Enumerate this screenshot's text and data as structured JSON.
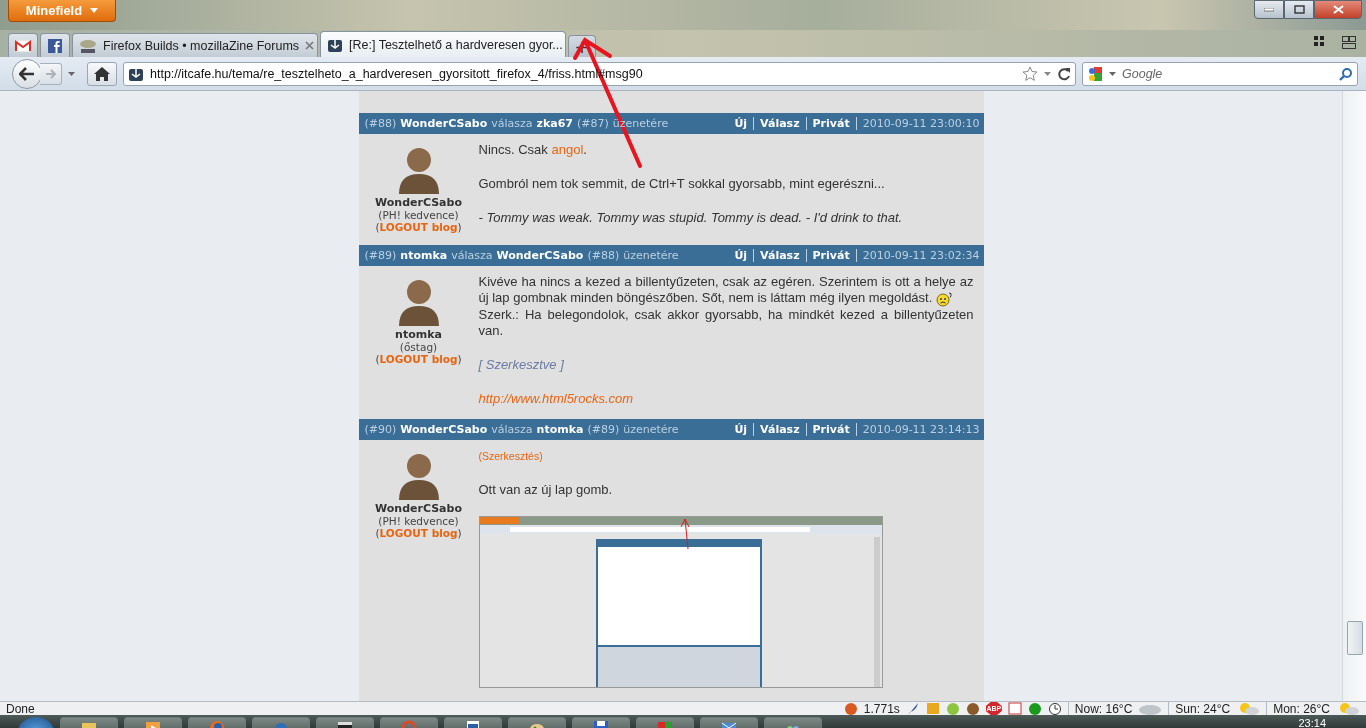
{
  "window": {
    "app_button": "Minefield"
  },
  "tabs": [
    {
      "kind": "pinned",
      "selected": false
    },
    {
      "kind": "pinned",
      "selected": false
    },
    {
      "kind": "normal",
      "label": "Firefox Builds • mozillaZine Forums",
      "selected": false
    },
    {
      "kind": "normal",
      "label": "[Re:] Tesztelhető a hardveresen gyor...",
      "selected": true
    }
  ],
  "new_tab": "+",
  "nav": {
    "url": "http://itcafe.hu/tema/re_tesztelheto_a_hardveresen_gyorsitott_firefox_4/friss.html#msg90",
    "search_placeholder": "Google"
  },
  "posts": [
    {
      "number": "(#88)",
      "author": "WonderCSabo",
      "verb": "válasza",
      "reply_to": "zka67",
      "reply_number": "(#87)",
      "suffix": "üzenetére",
      "actions": [
        "Új",
        "Válasz",
        "Privát"
      ],
      "date": "2010-09-11 23:00:10",
      "user": {
        "name": "WonderCSabo",
        "rank": "(PH! kedvence)",
        "blog_before": "(",
        "blog": "LOGOUT blog",
        "blog_after": ")"
      },
      "body": [
        {
          "kind": "para",
          "parts": [
            {
              "kind": "text",
              "text": "Nincs. Csak "
            },
            {
              "kind": "link",
              "text": "angol"
            },
            {
              "kind": "text",
              "text": "."
            }
          ]
        },
        {
          "kind": "para",
          "parts": [
            {
              "kind": "text",
              "text": "Gombról nem tok semmit, de Ctrl+T sokkal gyorsabb, mint egerészni..."
            }
          ]
        },
        {
          "kind": "quote",
          "text": "- Tommy was weak. Tommy was stupid. Tommy is dead. - I'd drink to that."
        }
      ]
    },
    {
      "number": "(#89)",
      "author": "ntomka",
      "verb": "válasza",
      "reply_to": "WonderCSabo",
      "reply_number": "(#88)",
      "suffix": "üzenetére",
      "actions": [
        "Új",
        "Válasz",
        "Privát"
      ],
      "date": "2010-09-11 23:02:34",
      "user": {
        "name": "ntomka",
        "rank": "(őstag)",
        "blog_before": "(",
        "blog": "LOGOUT blog",
        "blog_after": ")"
      },
      "body": [
        {
          "kind": "para",
          "parts": [
            {
              "kind": "text",
              "text": "Kivéve ha nincs a kezed a billentyűzeten, csak az egéren. Szerintem is ott a helye az új lap gombnak minden böngészőben. Sőt, nem is láttam még ilyen megoldást. "
            },
            {
              "kind": "emoticon"
            },
            {
              "kind": "break"
            },
            {
              "kind": "text",
              "text": "Szerk.: Ha belegondolok, csak akkor gyorsabb, ha mindkét kezed a billentyűzeten van."
            }
          ]
        },
        {
          "kind": "edited",
          "text": "[ Szerkesztve ]"
        },
        {
          "kind": "signature",
          "text": "http://www.html5rocks.com"
        }
      ]
    },
    {
      "number": "(#90)",
      "author": "WonderCSabo",
      "verb": "válasza",
      "reply_to": "ntomka",
      "reply_number": "(#89)",
      "suffix": "üzenetére",
      "actions": [
        "Új",
        "Válasz",
        "Privát"
      ],
      "date": "2010-09-11 23:14:13",
      "user": {
        "name": "WonderCSabo",
        "rank": "(PH! kedvence)",
        "blog_before": "(",
        "blog": "LOGOUT blog",
        "blog_after": ")"
      },
      "body": [
        {
          "kind": "edit-link",
          "text": "(Szerkesztés)"
        },
        {
          "kind": "para",
          "parts": [
            {
              "kind": "text",
              "text": "Ott van az új lap gomb."
            }
          ]
        },
        {
          "kind": "image"
        }
      ]
    }
  ],
  "status_bar": {
    "status": "Done",
    "load_time": "1.771s",
    "adblock": "ABP",
    "weather": [
      {
        "label": "Now: 16°C"
      },
      {
        "label": "Sun: 24°C"
      },
      {
        "label": "Mon: 26°C"
      }
    ]
  },
  "taskbar": {
    "clock": "23:14"
  }
}
